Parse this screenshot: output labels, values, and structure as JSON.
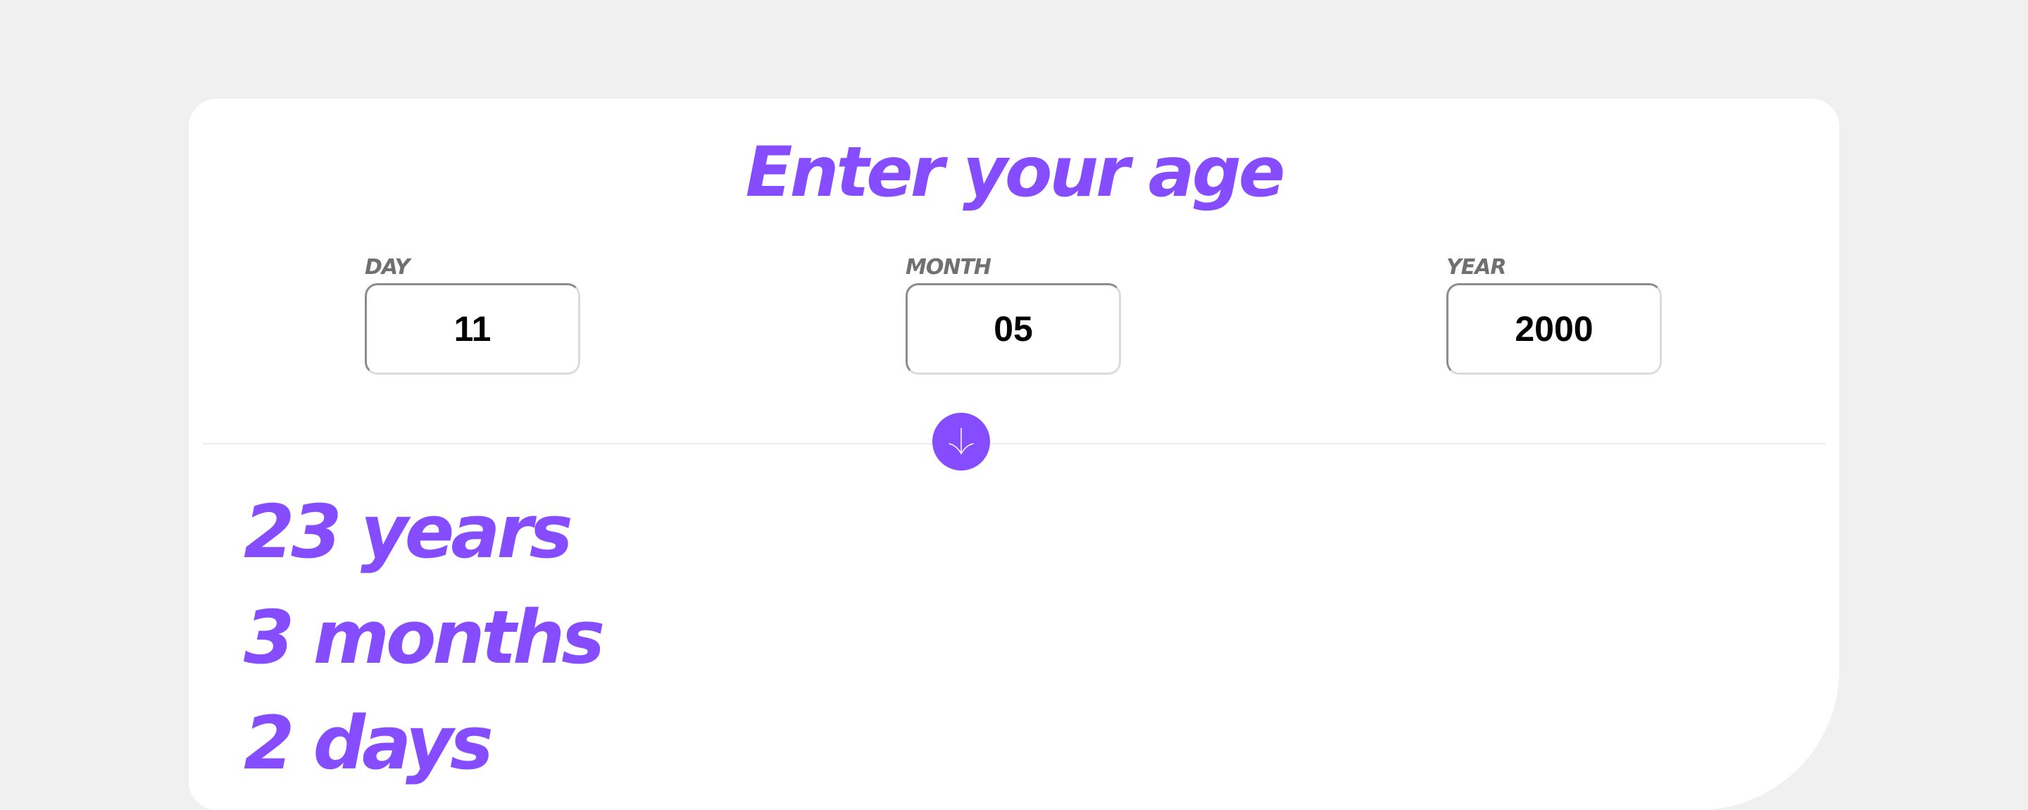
{
  "header": {
    "title": "Enter your age"
  },
  "form": {
    "day": {
      "label": "DAY",
      "value": "11"
    },
    "month": {
      "label": "MONTH",
      "value": "05"
    },
    "year": {
      "label": "YEAR",
      "value": "2000"
    }
  },
  "submit": {
    "icon": "arrow-down-icon"
  },
  "results": {
    "years_value": "23",
    "years_unit": "years",
    "months_value": "3",
    "months_unit": "months",
    "days_value": "2",
    "days_unit": "days"
  },
  "colors": {
    "accent": "#854dff",
    "background": "#f0f0f0",
    "card": "#ffffff",
    "label": "#716f6f"
  }
}
